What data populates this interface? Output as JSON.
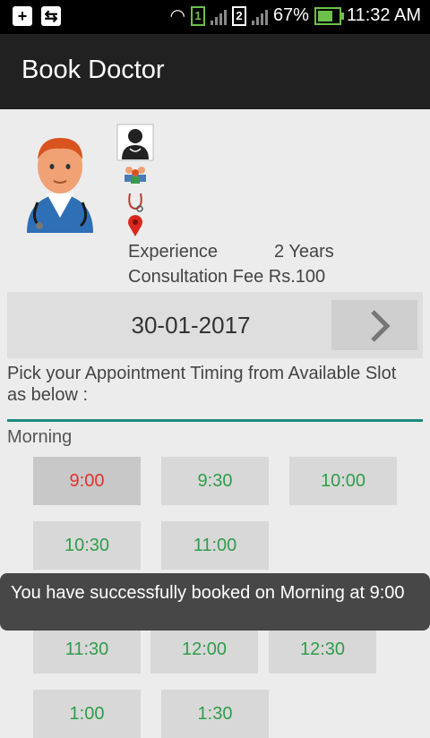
{
  "status_bar": {
    "sim1": "1",
    "sim2": "2",
    "battery": "67%",
    "battery_level": 0.67,
    "time": "11:32 AM"
  },
  "appbar": {
    "title": "Book Doctor"
  },
  "doctor": {
    "icons": [
      "doctor-avatar-icon",
      "doctor-icon",
      "group-icon",
      "stethoscope-icon",
      "location-pin-icon"
    ],
    "experience_label": "Experience",
    "experience_value": "2 Years",
    "fee_label": "Consultation Fee",
    "fee_value": "Rs.100"
  },
  "date": {
    "value": "30-01-2017"
  },
  "instruction": "Pick your Appointment Timing from Available Slot as below :",
  "section": "Morning",
  "slots": [
    {
      "time": "9:00",
      "booked": true
    },
    {
      "time": "9:30",
      "booked": false
    },
    {
      "time": "10:00",
      "booked": false
    },
    {
      "time": "10:30",
      "booked": false
    },
    {
      "time": "11:00",
      "booked": false
    },
    {
      "time": "11:30",
      "booked": false
    },
    {
      "time": "12:00",
      "booked": false
    },
    {
      "time": "12:30",
      "booked": false
    },
    {
      "time": "1:00",
      "booked": false
    },
    {
      "time": "1:30",
      "booked": false
    }
  ],
  "toast": "You have successfully booked on Morning at 9:00",
  "colors": {
    "accent": "#1a8a80",
    "slot_text": "#2f9d4a",
    "booked_text": "#e0342e"
  }
}
